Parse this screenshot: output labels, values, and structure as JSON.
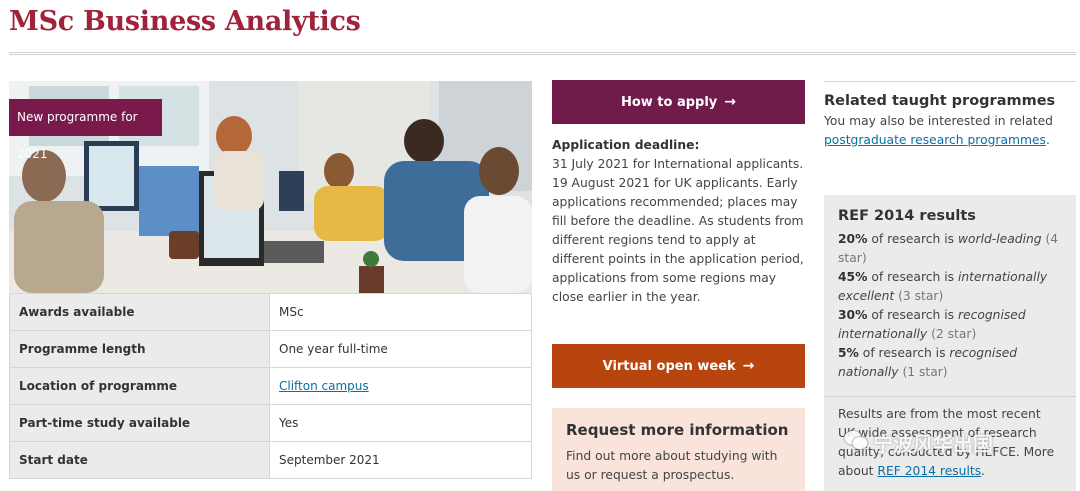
{
  "page": {
    "title": "MSc Business Analytics"
  },
  "hero": {
    "badge": "New programme for 2021"
  },
  "facts": [
    {
      "label": "Awards available",
      "value": "MSc",
      "link": false
    },
    {
      "label": "Programme length",
      "value": "One year full-time",
      "link": false
    },
    {
      "label": "Location of programme",
      "value": "Clifton campus",
      "link": true
    },
    {
      "label": "Part-time study available",
      "value": "Yes",
      "link": false
    },
    {
      "label": "Start date",
      "value": "September 2021",
      "link": false
    }
  ],
  "apply": {
    "label": "How to apply",
    "arrow": "→"
  },
  "deadline": {
    "heading": "Application deadline:",
    "text": "31 July 2021 for International applicants. 19 August 2021 for UK applicants. Early applications recommended; places may fill before the deadline. As students from different regions tend to apply at different points in the application period, applications from some regions may close earlier in the year."
  },
  "open_week": {
    "label": "Virtual open week",
    "arrow": "→"
  },
  "request": {
    "heading": "Request more information",
    "text": "Find out more about studying with us or request a prospectus."
  },
  "related": {
    "heading": "Related taught programmes",
    "text": "You may also be interested in related",
    "link": "postgraduate research programmes",
    "end": "."
  },
  "ref": {
    "heading": "REF 2014 results",
    "items": [
      {
        "pct": "20%",
        "mid": " of research is ",
        "em": "world-leading",
        "tail": " (4 star)"
      },
      {
        "pct": "45%",
        "mid": " of research is ",
        "em": "internationally excellent",
        "tail": " (3 star)"
      },
      {
        "pct": "30%",
        "mid": " of research is ",
        "em": "recognised internationally",
        "tail": " (2 star)"
      },
      {
        "pct": "5%",
        "mid": " of research is ",
        "em": "recognised nationally",
        "tail": " (1 star)"
      }
    ],
    "note_1": "Results are from the most recent",
    "note_2": "UK-wide assessment of research",
    "note_3": "quality, conducted by HEFCE. More",
    "note_4": "about",
    "note_link": "REF 2014 results",
    "note_end": "."
  },
  "watermark": {
    "text": "宁波风华出国"
  },
  "colors": {
    "brand_red": "#a0233a",
    "apply_purple": "#701b4c",
    "open_orange": "#b9450e",
    "link": "#0a6fa3"
  }
}
